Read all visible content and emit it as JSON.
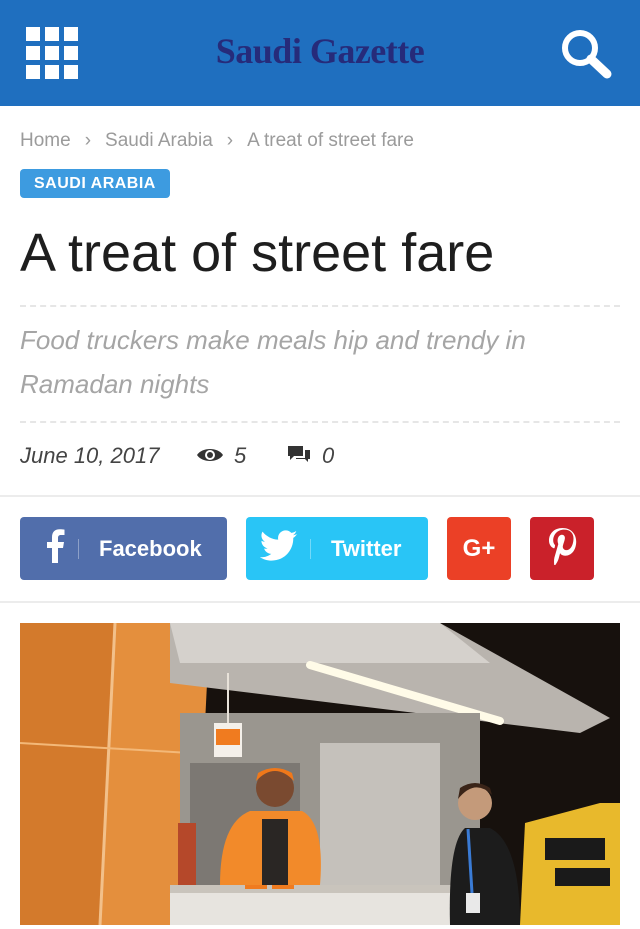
{
  "header": {
    "logo_text": "Saudi Gazette",
    "menu_icon": "grid-menu-icon",
    "search_icon": "search-icon",
    "bar_color": "#1f6fbf",
    "logo_color": "#262b7a"
  },
  "breadcrumb": {
    "items": [
      "Home",
      "Saudi Arabia",
      "A treat of street fare"
    ],
    "separator": "›"
  },
  "category": {
    "label": "SAUDI ARABIA",
    "color": "#3d9be0"
  },
  "article": {
    "title": "A treat of street fare",
    "subtitle": "Food truckers make meals hip and trendy in Ramadan nights",
    "date": "June 10, 2017",
    "views": "5",
    "comments": "0"
  },
  "share": {
    "facebook_label": "Facebook",
    "twitter_label": "Twitter",
    "googleplus_label": "G+",
    "colors": {
      "facebook": "#516eab",
      "twitter": "#29c5f6",
      "googleplus": "#eb4026",
      "pinterest": "#ca212a"
    }
  },
  "image": {
    "icon": "food-truck-photo"
  }
}
